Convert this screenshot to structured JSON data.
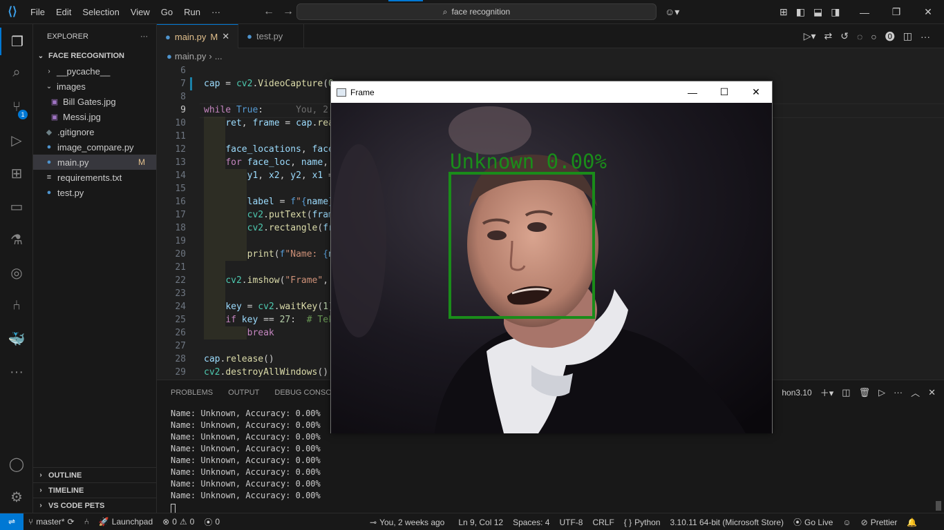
{
  "titlebar": {
    "menu": [
      "File",
      "Edit",
      "Selection",
      "View",
      "Go",
      "Run",
      "···"
    ],
    "search": "face recognition"
  },
  "sidebar": {
    "header": "EXPLORER",
    "root": "FACE RECOGNITION",
    "items": [
      {
        "label": "__pycache__",
        "type": "folder-collapsed",
        "depth": 1
      },
      {
        "label": "images",
        "type": "folder-open",
        "depth": 1
      },
      {
        "label": "Bill Gates.jpg",
        "type": "image",
        "depth": 2
      },
      {
        "label": "Messi.jpg",
        "type": "image",
        "depth": 2
      },
      {
        "label": ".gitignore",
        "type": "git",
        "depth": 1
      },
      {
        "label": "image_compare.py",
        "type": "python",
        "depth": 1
      },
      {
        "label": "main.py",
        "type": "python",
        "depth": 1,
        "badge": "M",
        "selected": true
      },
      {
        "label": "requirements.txt",
        "type": "text",
        "depth": 1
      },
      {
        "label": "test.py",
        "type": "python",
        "depth": 1
      }
    ],
    "sections": [
      "OUTLINE",
      "TIMELINE",
      "VS CODE PETS"
    ]
  },
  "activity": {
    "scm_badge": "1"
  },
  "tabs": [
    {
      "label": "main.py",
      "badge": "M",
      "active": true
    },
    {
      "label": "test.py",
      "active": false
    }
  ],
  "breadcrumb": {
    "file": "main.py",
    "rest": "..."
  },
  "code": {
    "line_numbers": [
      "6",
      "7",
      "8",
      "9",
      "10",
      "11",
      "12",
      "13",
      "14",
      "15",
      "16",
      "17",
      "18",
      "19",
      "20",
      "21",
      "22",
      "23",
      "24",
      "25",
      "26",
      "27",
      "28",
      "29"
    ],
    "blame": "You, 2"
  },
  "panel": {
    "tabs": [
      "PROBLEMS",
      "OUTPUT",
      "DEBUG CONSOLE"
    ],
    "interpreter": "hon3.10",
    "terminal_lines": [
      "Name: Unknown, Accuracy: 0.00%",
      "Name: Unknown, Accuracy: 0.00%",
      "Name: Unknown, Accuracy: 0.00%",
      "Name: Unknown, Accuracy: 0.00%",
      "Name: Unknown, Accuracy: 0.00%",
      "Name: Unknown, Accuracy: 0.00%",
      "Name: Unknown, Accuracy: 0.00%",
      "Name: Unknown, Accuracy: 0.00%"
    ]
  },
  "frame": {
    "title": "Frame",
    "label": "Unknown 0.00%",
    "box_color": "#1a8c1a"
  },
  "statusbar": {
    "branch": "master*",
    "launchpad": "Launchpad",
    "errors": "0",
    "warnings": "0",
    "ports": "0",
    "blame": "You, 2 weeks ago",
    "position": "Ln 9, Col 12",
    "spaces": "Spaces: 4",
    "encoding": "UTF-8",
    "eol": "CRLF",
    "language": "Python",
    "interpreter": "3.10.11 64-bit (Microsoft Store)",
    "golive": "Go Live",
    "prettier": "Prettier"
  }
}
